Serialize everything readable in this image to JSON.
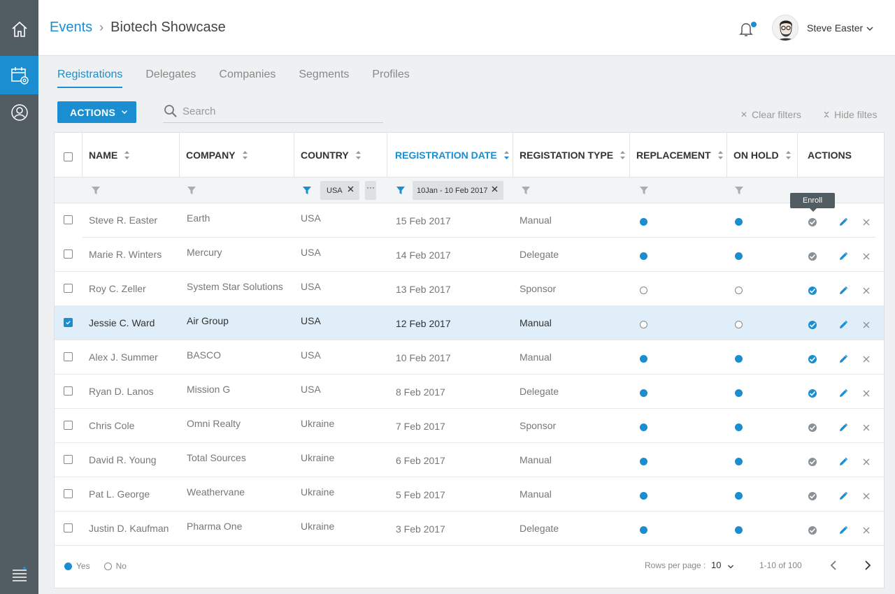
{
  "breadcrumb": {
    "parent": "Events",
    "separator": "›",
    "current": "Biotech Showcase"
  },
  "user": {
    "name": "Steve Easter"
  },
  "tabs": [
    {
      "label": "Registrations"
    },
    {
      "label": "Delegates"
    },
    {
      "label": "Companies"
    },
    {
      "label": "Segments"
    },
    {
      "label": "Profiles"
    }
  ],
  "toolbar": {
    "actions_label": "ACTIONS",
    "search_placeholder": "Search",
    "clear_filters": "Clear filters",
    "hide_filters": "Hide filtes"
  },
  "columns": {
    "name": "NAME",
    "company": "COMPANY",
    "country": "COUNTRY",
    "date": "REGISTRATION DATE",
    "type": "REGISTATION TYPE",
    "replacement": "REPLACEMENT",
    "onhold": "ON HOLD",
    "actions": "ACTIONS"
  },
  "filters": {
    "country_chip": "USA",
    "date_chip": "10Jan - 10 Feb 2017",
    "more": "···"
  },
  "tooltip": "Enroll",
  "rows": [
    {
      "name": "Steve R. Easter",
      "company": "Earth",
      "country": "USA",
      "date": "15 Feb 2017",
      "type": "Manual",
      "replacement": true,
      "onhold": true,
      "enrolled": false,
      "selected": false
    },
    {
      "name": "Marie R. Winters",
      "company": "Mercury",
      "country": "USA",
      "date": "14 Feb 2017",
      "type": "Delegate",
      "replacement": true,
      "onhold": true,
      "enrolled": false,
      "selected": false
    },
    {
      "name": "Roy C. Zeller",
      "company": "System Star Solutions",
      "country": "USA",
      "date": "13 Feb 2017",
      "type": "Sponsor",
      "replacement": false,
      "onhold": false,
      "enrolled": true,
      "selected": false
    },
    {
      "name": "Jessie C. Ward",
      "company": "Air Group",
      "country": "USA",
      "date": "12 Feb 2017",
      "type": "Manual",
      "replacement": false,
      "onhold": false,
      "enrolled": true,
      "selected": true
    },
    {
      "name": "Alex J. Summer",
      "company": "BASCO",
      "country": "USA",
      "date": "10 Feb 2017",
      "type": "Manual",
      "replacement": true,
      "onhold": true,
      "enrolled": true,
      "selected": false
    },
    {
      "name": "Ryan D. Lanos",
      "company": "Mission G",
      "country": "USA",
      "date": "8 Feb 2017",
      "type": "Delegate",
      "replacement": true,
      "onhold": true,
      "enrolled": true,
      "selected": false
    },
    {
      "name": "Chris Cole",
      "company": "Omni Realty",
      "country": "Ukraine",
      "date": "7 Feb 2017",
      "type": "Sponsor",
      "replacement": true,
      "onhold": true,
      "enrolled": false,
      "selected": false
    },
    {
      "name": "David R. Young",
      "company": "Total Sources",
      "country": "Ukraine",
      "date": "6 Feb 2017",
      "type": "Manual",
      "replacement": true,
      "onhold": true,
      "enrolled": false,
      "selected": false
    },
    {
      "name": "Pat L. George",
      "company": "Weathervane",
      "country": "Ukraine",
      "date": "5  Feb 2017",
      "type": "Manual",
      "replacement": true,
      "onhold": true,
      "enrolled": false,
      "selected": false
    },
    {
      "name": "Justin D. Kaufman",
      "company": "Pharma One",
      "country": "Ukraine",
      "date": "3 Feb 2017",
      "type": "Delegate",
      "replacement": true,
      "onhold": true,
      "enrolled": false,
      "selected": false
    }
  ],
  "footer": {
    "legend_yes": "Yes",
    "legend_no": "No",
    "rows_per_page_label": "Rows per page :",
    "rows_per_page": "10",
    "page_info": "1-10 of 100"
  },
  "colors": {
    "accent": "#1a8ed0",
    "sidebar": "#525c63",
    "selected_row": "#dfeef8"
  },
  "icons": {
    "sidebar": [
      "home-icon",
      "calendar-settings-icon",
      "user-circle-icon",
      "menu-list-icon"
    ],
    "toolbar": [
      "search-icon",
      "close-icon",
      "collapse-icon",
      "chevron-down-icon"
    ],
    "row_actions": [
      "check-circle-icon",
      "pencil-icon",
      "close-icon"
    ],
    "header": [
      "bell-icon",
      "avatar"
    ]
  }
}
